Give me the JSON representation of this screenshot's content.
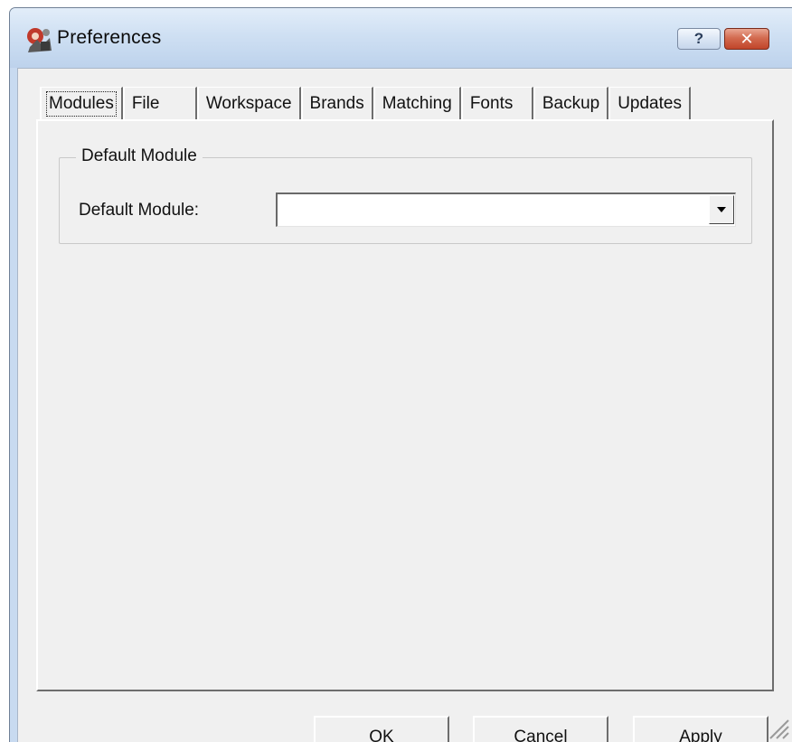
{
  "window": {
    "title": "Preferences",
    "help_button": "?",
    "close_button": "✕"
  },
  "tabs": [
    {
      "label": "Modules",
      "active": true
    },
    {
      "label": "File",
      "active": false
    },
    {
      "label": "Workspace",
      "active": false
    },
    {
      "label": "Brands",
      "active": false
    },
    {
      "label": "Matching",
      "active": false
    },
    {
      "label": "Fonts",
      "active": false
    },
    {
      "label": "Backup",
      "active": false
    },
    {
      "label": "Updates",
      "active": false
    }
  ],
  "groupbox": {
    "title": "Default Module",
    "field_label": "Default Module:",
    "select_value": ""
  },
  "buttons": {
    "ok": {
      "mnemonic": "O",
      "rest": "K"
    },
    "cancel": {
      "mnemonic": "C",
      "rest": "ancel"
    },
    "apply": {
      "mnemonic": "A",
      "rest": "pply"
    }
  },
  "colors": {
    "titlebar_top": "#e2edf9",
    "titlebar_bottom": "#bdd2ec",
    "dialog_face": "#f0f0f0",
    "close_button": "#c1452a"
  },
  "icons": [
    "app-icon",
    "help-icon",
    "close-icon",
    "dropdown-arrow-icon",
    "size-grip-icon"
  ]
}
